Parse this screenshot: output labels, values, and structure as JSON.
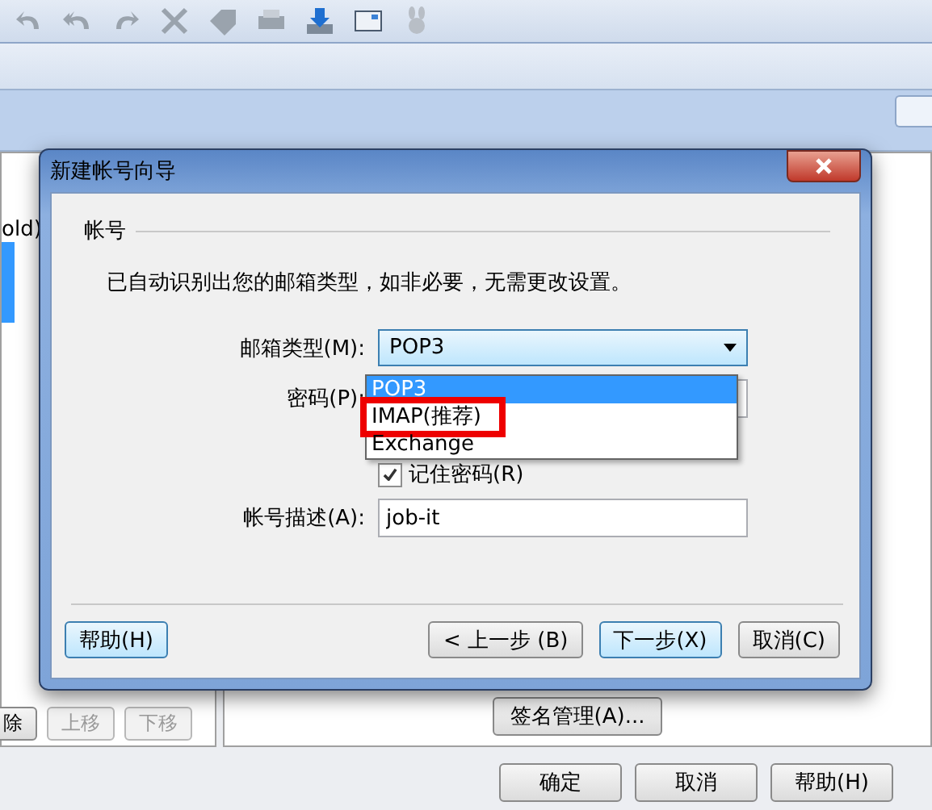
{
  "background": {
    "list_item": "old)",
    "list_buttons": [
      {
        "label": "除",
        "disabled": false
      },
      {
        "label": "上移",
        "disabled": true
      },
      {
        "label": "下移",
        "disabled": true
      }
    ],
    "signature_button": "签名管理(A)...",
    "buttons": [
      "确定",
      "取消",
      "帮助(H)"
    ]
  },
  "dialog": {
    "title": "新建帐号向导",
    "group_title": "帐号",
    "message": "已自动识别出您的邮箱类型，如非必要，无需更改设置。",
    "mail_type": {
      "label": "邮箱类型(M):",
      "value": "POP3",
      "expanded": true,
      "options": [
        {
          "label": "POP3",
          "selected": true,
          "highlighted": false
        },
        {
          "label": "IMAP(推荐)",
          "selected": false,
          "highlighted": true
        },
        {
          "label": "Exchange",
          "selected": false,
          "highlighted": false
        }
      ]
    },
    "password": {
      "label": "密码(P):"
    },
    "remember": {
      "label": "记住密码(R)",
      "checked": true
    },
    "description": {
      "label": "帐号描述(A):",
      "value": "job-it"
    },
    "buttons": [
      {
        "label": "帮助(H)",
        "kind": "default"
      },
      {
        "label": "< 上一步 (B)",
        "kind": "normal"
      },
      {
        "label": "下一步(X)",
        "kind": "default"
      },
      {
        "label": "取消(C)",
        "kind": "normal"
      }
    ]
  }
}
